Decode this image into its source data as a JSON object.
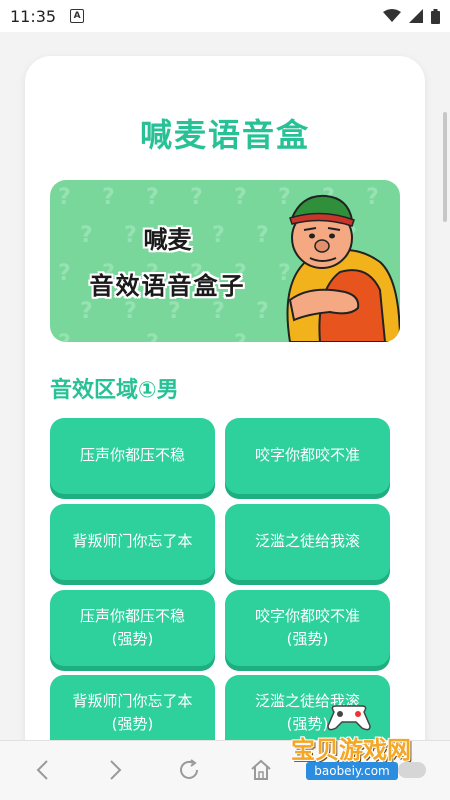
{
  "status_bar": {
    "time": "11:35",
    "notification_icon": "a-icon",
    "icons": [
      "wifi-icon",
      "signal-icon",
      "battery-icon"
    ]
  },
  "app": {
    "title": "喊麦语音盒"
  },
  "banner": {
    "line1": "喊麦",
    "line2": "音效语音盒子",
    "background_color": "#79d79c"
  },
  "section": {
    "title": "音效区域①男"
  },
  "sound_buttons": [
    {
      "label": "压声你都压不稳"
    },
    {
      "label": "咬字你都咬不准"
    },
    {
      "label": "背叛师门你忘了本"
    },
    {
      "label": "泛滥之徒给我滚"
    },
    {
      "label": "压声你都压不稳\n(强势)"
    },
    {
      "label": "咬字你都咬不准\n(强势)"
    },
    {
      "label": "背叛师门你忘了本\n(强势)"
    },
    {
      "label": "泛滥之徒给我滚\n(强势)"
    },
    {
      "label": ""
    },
    {
      "label": ""
    }
  ],
  "nav": {
    "icons": [
      "back-icon",
      "forward-icon",
      "refresh-icon",
      "home-icon"
    ]
  },
  "watermark": {
    "text": "宝贝游戏网",
    "url": "baobeiy.com"
  },
  "colors": {
    "accent": "#27c195",
    "button": "#2ed19b",
    "button_shadow": "#1fae80"
  }
}
